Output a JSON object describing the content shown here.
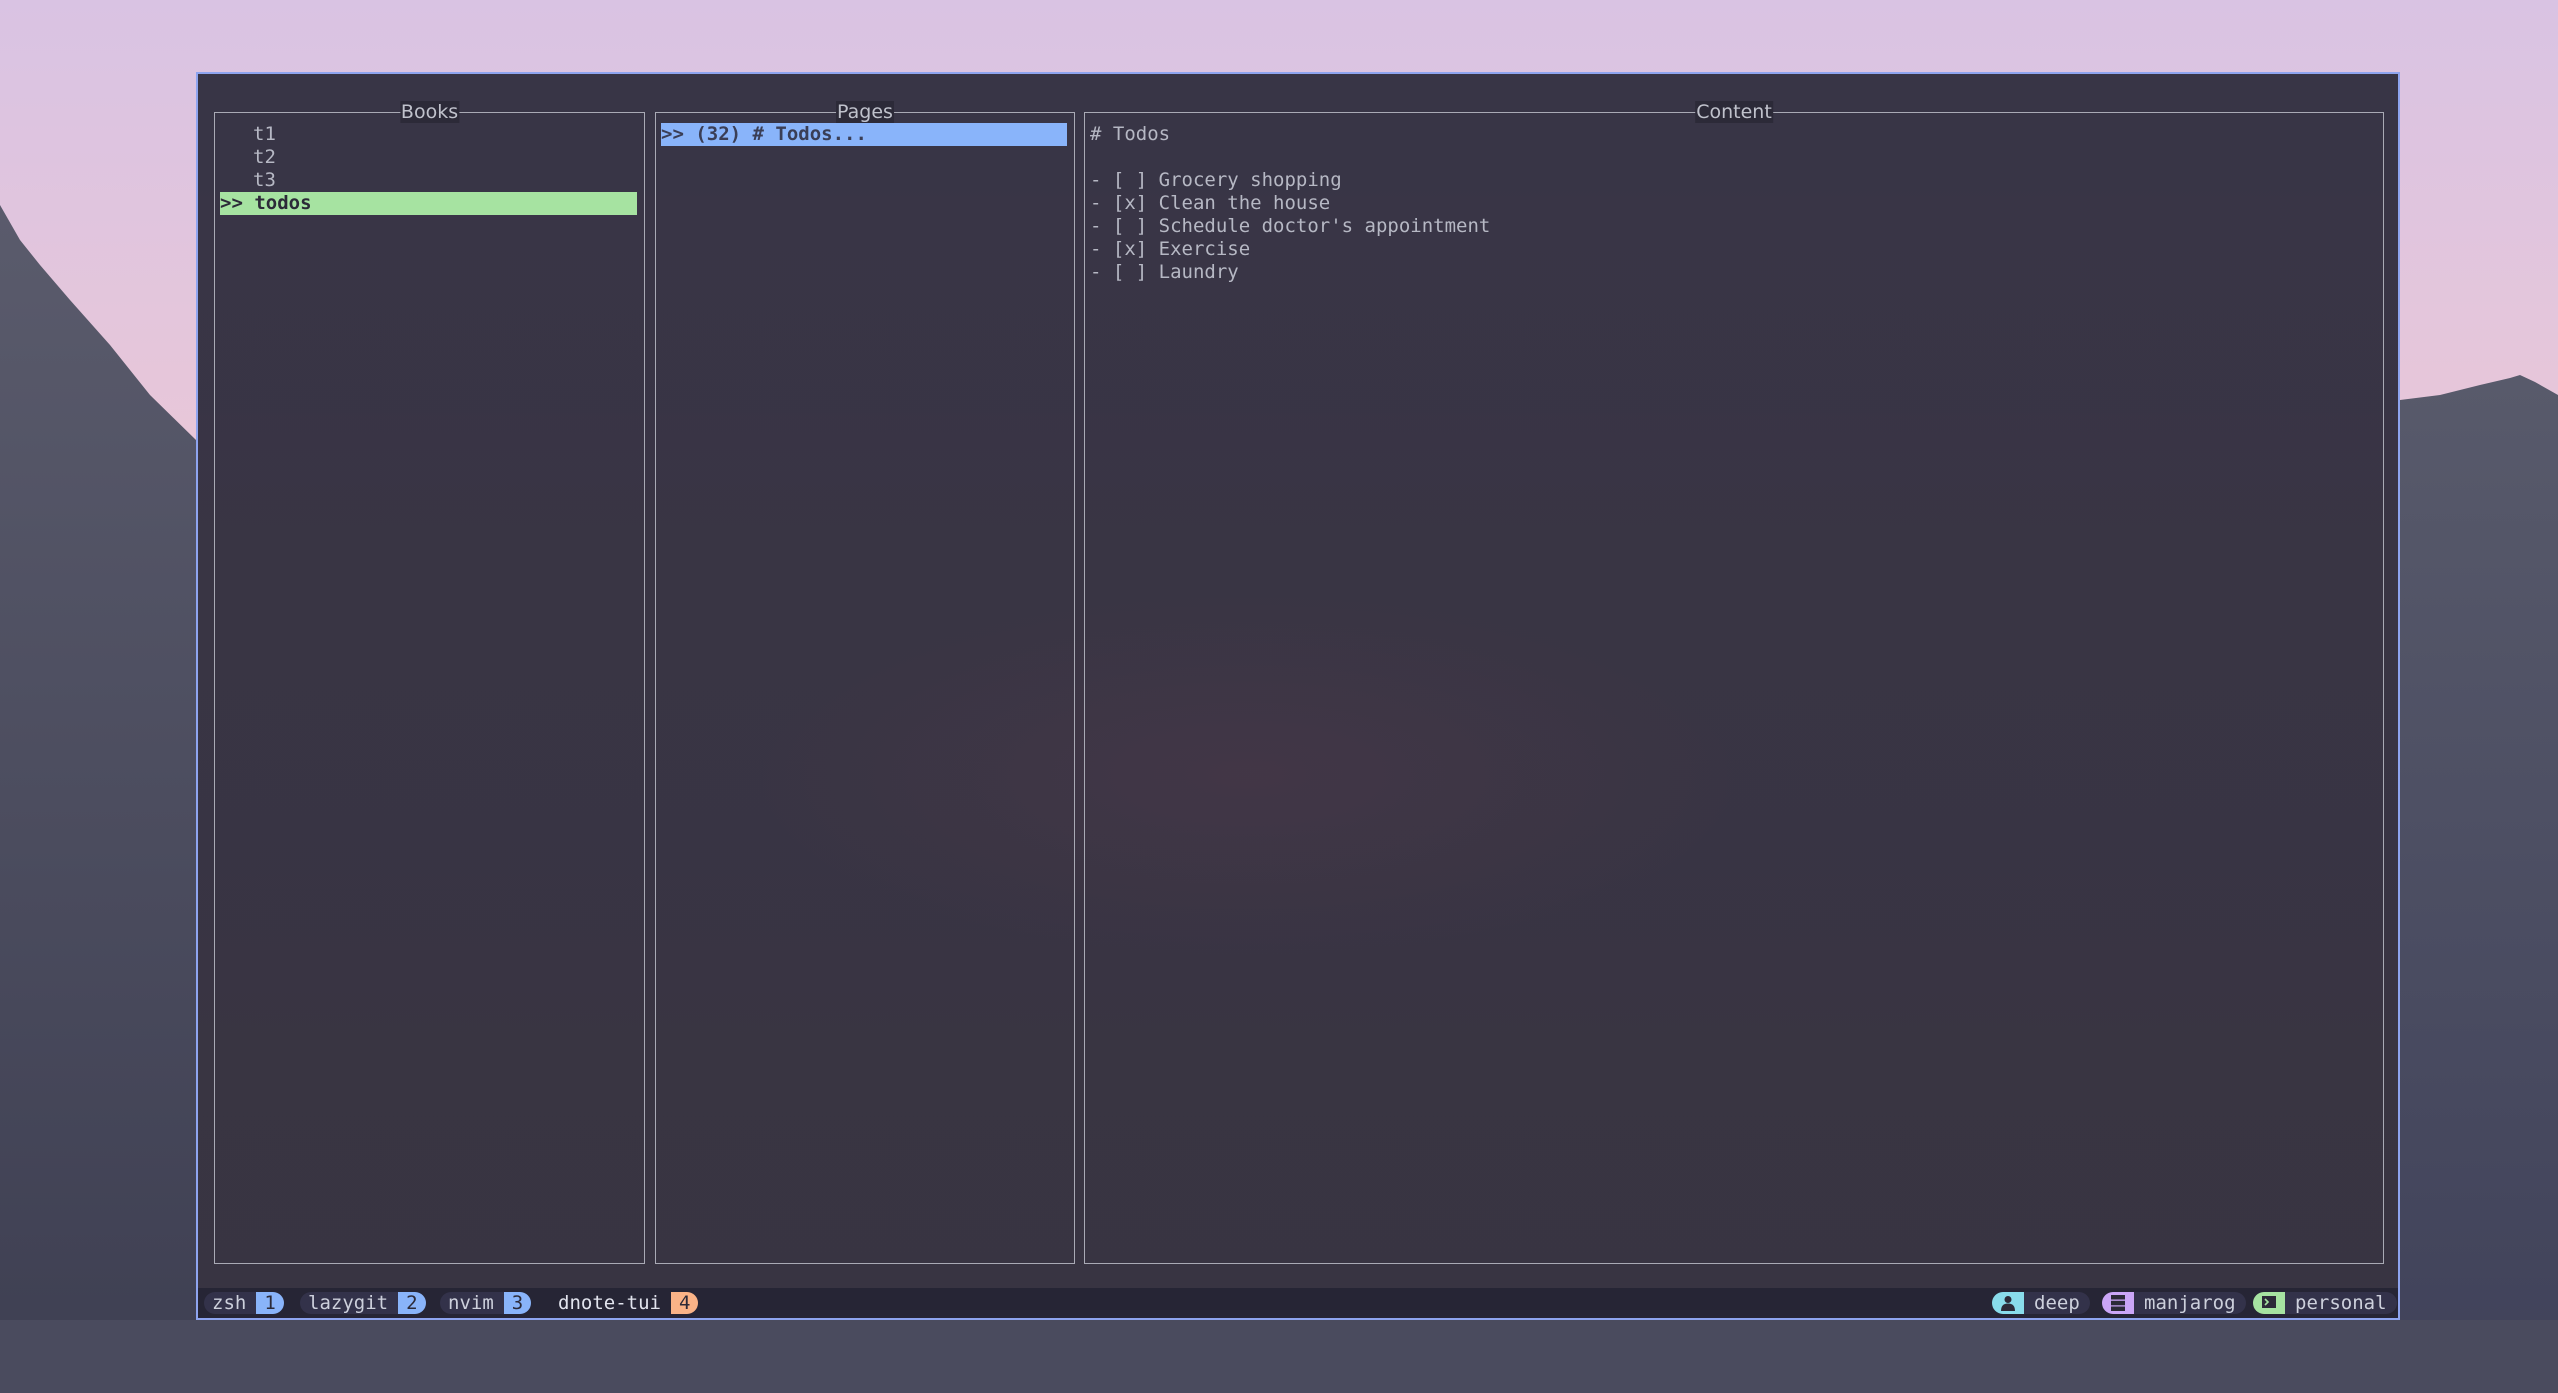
{
  "panels": {
    "books": {
      "title": "Books",
      "items": [
        "t1",
        "t2",
        "t3"
      ],
      "selected": ">> todos"
    },
    "pages": {
      "title": "Pages",
      "selected": ">> (32) # Todos..."
    },
    "content": {
      "title": "Content",
      "lines": [
        "# Todos",
        "",
        "- [ ] Grocery shopping",
        "- [x] Clean the house",
        "- [ ] Schedule doctor's appointment",
        "- [x] Exercise",
        "- [ ] Laundry"
      ]
    }
  },
  "statusbar": {
    "windows": [
      {
        "label": "zsh",
        "number": "1",
        "color": "#89b4fa"
      },
      {
        "label": "lazygit",
        "number": "2",
        "color": "#89b4fa"
      },
      {
        "label": "nvim",
        "number": "3",
        "color": "#89b4fa"
      },
      {
        "label": "dnote-tui",
        "number": "4",
        "color": "#fab387",
        "active": true
      }
    ],
    "right": [
      {
        "icon": "user-icon",
        "text": "deep",
        "color": "#89dceb"
      },
      {
        "icon": "server-icon",
        "text": "manjarog",
        "color": "#cba6f7"
      },
      {
        "icon": "terminal-session-icon",
        "text": "personal",
        "color": "#a6e3a1"
      }
    ]
  }
}
